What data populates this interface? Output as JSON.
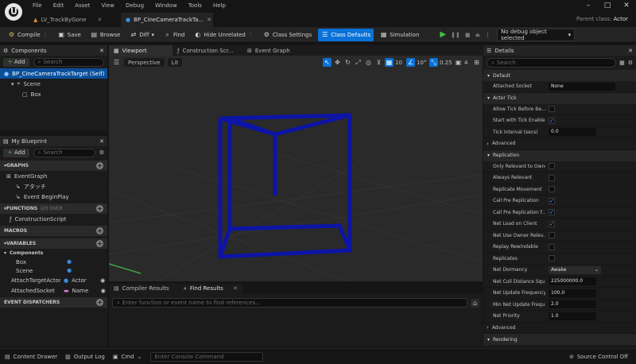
{
  "app": {
    "tabs": [
      {
        "label": "LV_TrackByGone"
      },
      {
        "label": "BP_CineCameraTrackTa..."
      }
    ],
    "menu": [
      "File",
      "Edit",
      "Asset",
      "View",
      "Debug",
      "Window",
      "Tools",
      "Help"
    ],
    "parent_class_label": "Parent class:",
    "parent_class_value": "Actor"
  },
  "toolbar": {
    "compile": "Compile",
    "save": "Save",
    "browse": "Browse",
    "diff": "Diff",
    "find": "Find",
    "hide_unrelated": "Hide Unrelated",
    "class_settings": "Class Settings",
    "class_defaults": "Class Defaults",
    "simulation": "Simulation",
    "debug_object": "No debug object selected"
  },
  "components": {
    "title": "Components",
    "add": "Add",
    "search_placeholder": "Search",
    "root": "BP_CineCameraTrackTarget (Self)",
    "scene": "Scene",
    "box": "Box"
  },
  "blueprint": {
    "title": "My Blueprint",
    "add": "Add",
    "search_placeholder": "Search",
    "graphs_header": "GRAPHS",
    "event_graph": "EventGraph",
    "node1": "アタッチ",
    "node2": "Event BeginPlay",
    "functions_header": "FUNCTIONS",
    "functions_count": "(20 OVER",
    "construction_script": "ConstructionScript",
    "macros_header": "MACROS",
    "variables_header": "VARIABLES",
    "components_group": "Components",
    "var_box": "Box",
    "var_scene": "Scene",
    "vars": [
      {
        "name": "AttachTargetActor",
        "type": "Actor"
      },
      {
        "name": "AttachedSocket",
        "type": "Name"
      }
    ],
    "dispatchers_header": "EVENT DISPATCHERS"
  },
  "viewport": {
    "tabs": [
      "Viewport",
      "Construction Scr...",
      "Event Graph"
    ],
    "perspective": "Perspective",
    "lit": "Lit",
    "grid_snap": "10",
    "rot_snap": "10°",
    "scale_snap": "0.25",
    "cam_speed": "4"
  },
  "bottom": {
    "tabs": [
      "Compiler Results",
      "Find Results"
    ],
    "find_placeholder": "Enter function or event name to find references..."
  },
  "details": {
    "title": "Details",
    "search_placeholder": "Search",
    "default_section": "Default",
    "attached_socket_label": "Attached Socket",
    "attached_socket_value": "None",
    "actor_tick_section": "Actor Tick",
    "tick_rows": [
      {
        "label": "Allow Tick Before Be...",
        "checked": false
      },
      {
        "label": "Start with Tick Enabled",
        "checked": true
      }
    ],
    "tick_interval_label": "Tick Interval (secs)",
    "tick_interval_value": "0.0",
    "advanced": "Advanced",
    "replication_section": "Replication",
    "rep_rows": [
      {
        "label": "Only Relevant to Owner",
        "checked": false
      },
      {
        "label": "Always Relevant",
        "checked": false
      },
      {
        "label": "Replicate Movement",
        "checked": false
      },
      {
        "label": "Call Pre Replication",
        "checked": true
      },
      {
        "label": "Call Pre Replication f...",
        "checked": true
      },
      {
        "label": "Net Load on Client",
        "checked": true
      },
      {
        "label": "Net Use Owner Relev...",
        "checked": false
      },
      {
        "label": "Replay Rewindable",
        "checked": false
      },
      {
        "label": "Replicates",
        "checked": false
      }
    ],
    "net_dormancy_label": "Net Dormancy",
    "net_dormancy_value": "Awake",
    "net_cull_label": "Net Cull Distance Squ...",
    "net_cull_value": "225000000.0",
    "net_update_label": "Net Update Frequency",
    "net_update_value": "100.0",
    "min_net_label": "Min Net Update Frequ...",
    "min_net_value": "2.0",
    "net_priority_label": "Net Priority",
    "net_priority_value": "1.0",
    "advanced2": "Advanced",
    "rendering_section": "Rendering"
  },
  "status": {
    "content_drawer": "Content Drawer",
    "output_log": "Output Log",
    "cmd": "Cmd",
    "console_placeholder": "Enter Console Command",
    "source_control": "Source Control Off"
  }
}
